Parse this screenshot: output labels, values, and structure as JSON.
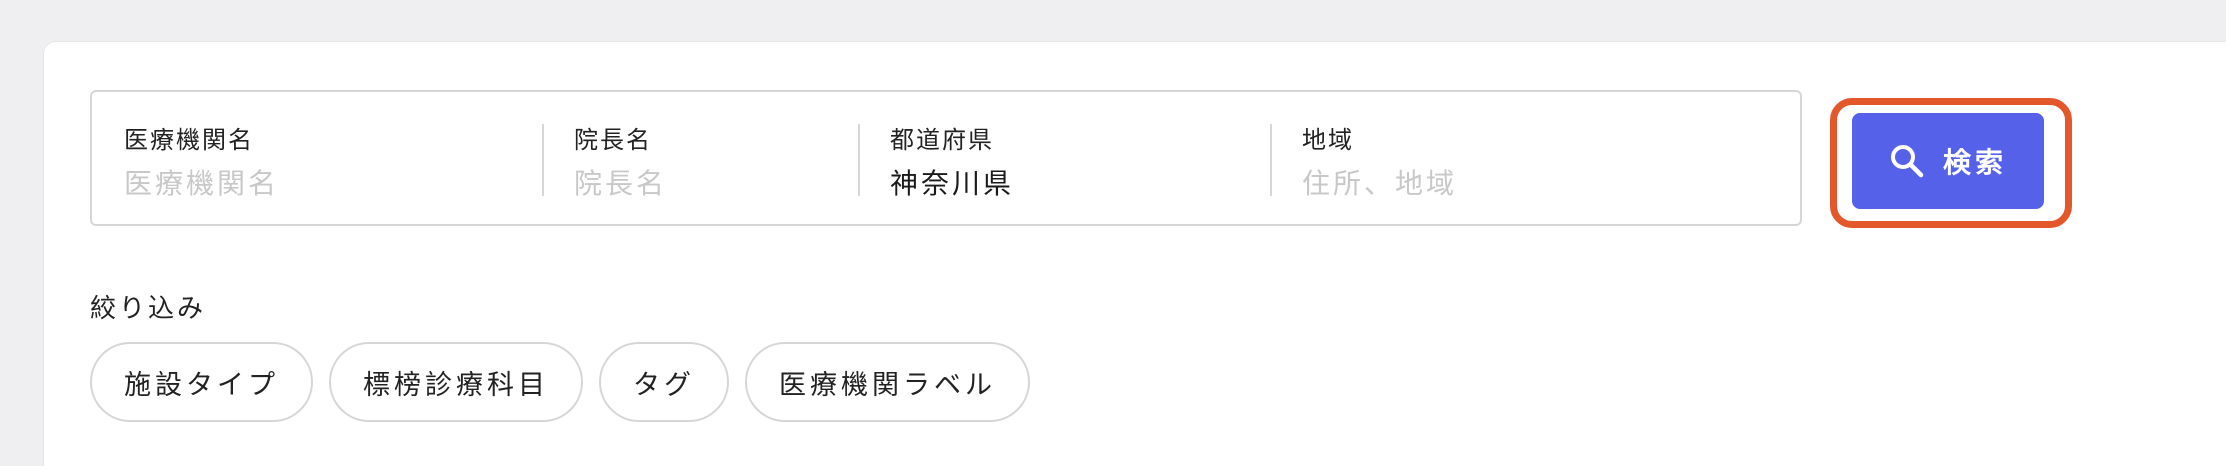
{
  "search": {
    "fields": [
      {
        "label": "医療機関名",
        "placeholder": "医療機関名",
        "value": ""
      },
      {
        "label": "院長名",
        "placeholder": "院長名",
        "value": ""
      },
      {
        "label": "都道府県",
        "placeholder": "",
        "value": "神奈川県"
      },
      {
        "label": "地域",
        "placeholder": "住所、地域",
        "value": ""
      }
    ],
    "button_label": "検索",
    "button_icon": "search-icon",
    "accent_color": "#5661e9",
    "highlight_color": "#e4572b"
  },
  "filters": {
    "title": "絞り込み",
    "chips": [
      "施設タイプ",
      "標榜診療科目",
      "タグ",
      "医療機関ラベル"
    ]
  }
}
